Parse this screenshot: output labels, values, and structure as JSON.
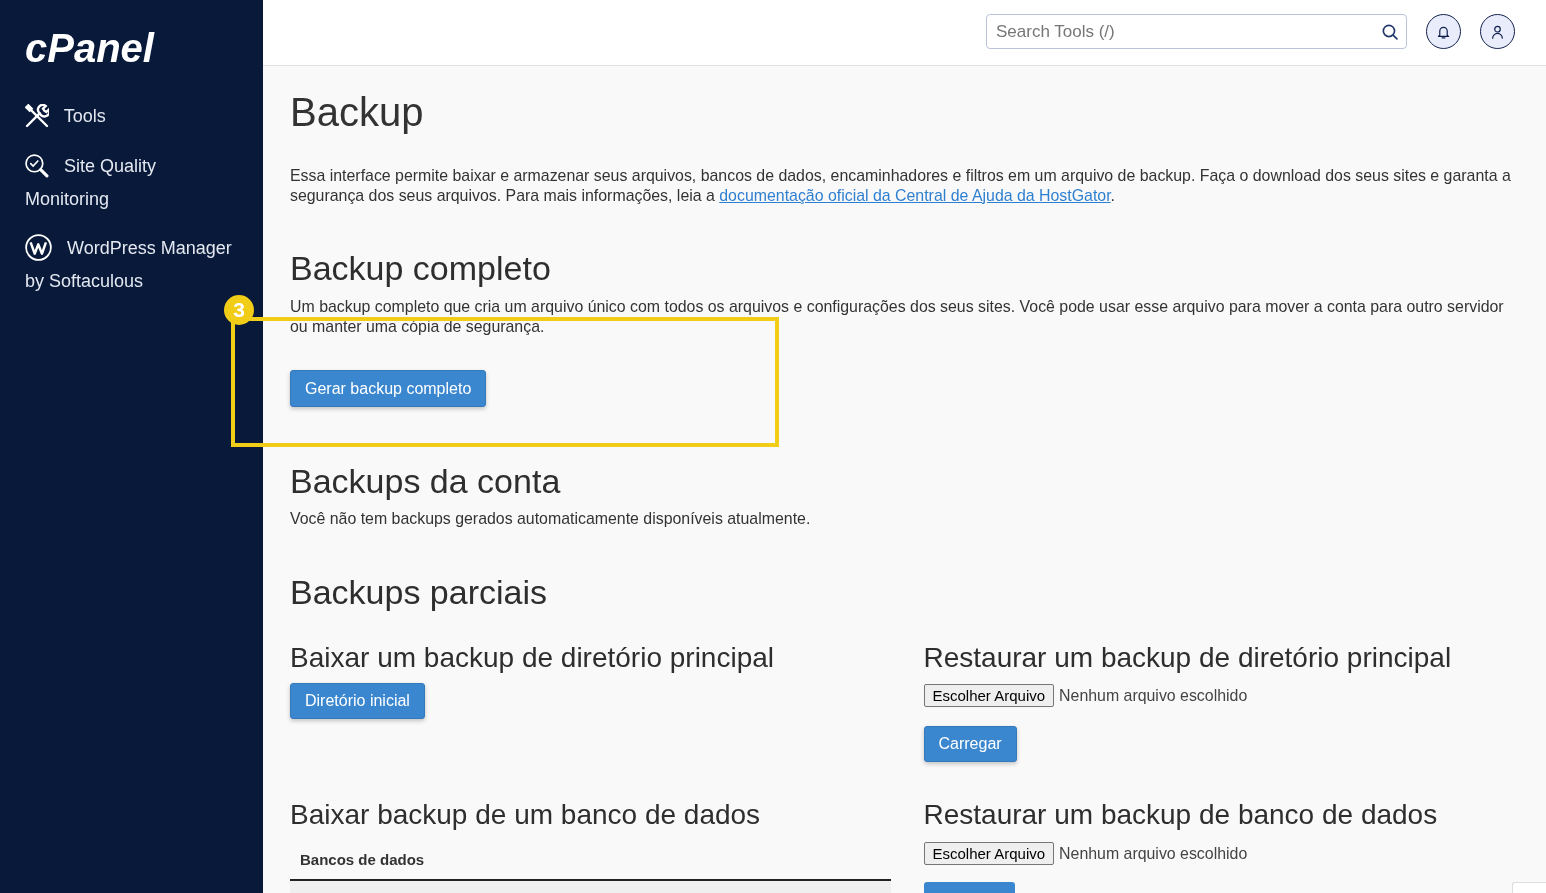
{
  "sidebar": {
    "logo": "cPanel",
    "items": [
      {
        "label": "Tools",
        "selected": false
      },
      {
        "label": "Site Quality Monitoring",
        "selected": false
      },
      {
        "label": "WordPress Manager by Softaculous",
        "selected": false
      }
    ]
  },
  "top_bar": {
    "search": {
      "placeholder": "Search Tools (/)"
    }
  },
  "page": {
    "title": "Backup",
    "intro": {
      "text": "Essa interface permite baixar e armazenar seus arquivos, bancos de dados, encaminhadores e filtros em um arquivo de backup. Faça o download dos seus sites e garanta a segurança dos seus arquivos. Para mais informações, leia a",
      "link": "documentação oficial da Central de Ajuda da HostGator",
      "text_after": "."
    },
    "full_backup": {
      "heading": "Backup completo",
      "description": "Um backup completo que cria um arquivo único com todos os arquivos e configurações dos seus sites. Você pode usar esse arquivo para mover a conta para outro servidor ou manter uma cópia de segurança.",
      "button": "Gerar backup completo"
    },
    "account_backups": {
      "heading": "Backups da conta",
      "message": "Você não tem backups gerados automaticamente disponíveis atualmente."
    },
    "partial_backups": {
      "heading": "Backups parciais",
      "download_home": {
        "heading": "Baixar um backup de diretório principal",
        "button": "Diretório inicial"
      },
      "restore_home": {
        "heading": "Restaurar um backup de diretório principal",
        "file_button": "Escolher Arquivo",
        "file_status": "Nenhum arquivo escolhido",
        "upload_button": "Carregar"
      },
      "download_database": {
        "heading": "Baixar backup de um banco de dados",
        "table": {
          "columns": [
            "Bancos de dados"
          ]
        }
      },
      "restore_database": {
        "heading": "Restaurar um backup de banco de dados",
        "file_button": "Escolher Arquivo",
        "file_status": "Nenhum arquivo escolhido"
      }
    }
  },
  "annotation": {
    "badge": "3"
  }
}
